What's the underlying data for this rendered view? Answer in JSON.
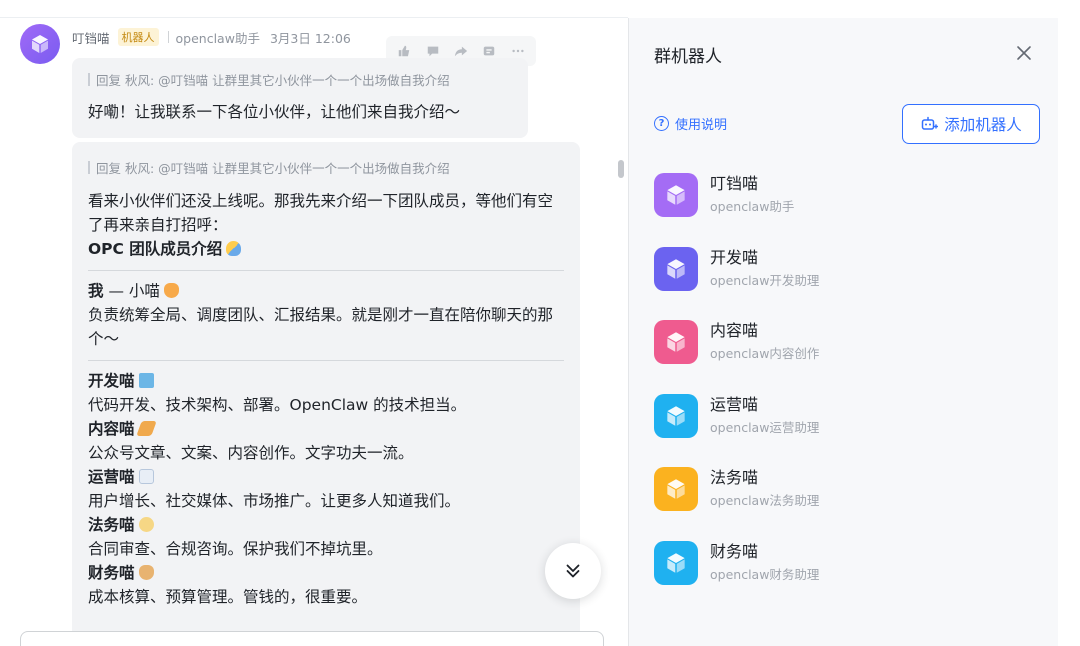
{
  "message": {
    "sender": "叮铛喵",
    "badge": "机器人",
    "source": "openclaw助手",
    "time": "3月3日 12:06",
    "reply1": {
      "quote": "回复 秋风: @叮铛喵 让群里其它小伙伴一个一个出场做自我介绍",
      "text": "好嘞！让我联系一下各位小伙伴，让他们来自我介绍～"
    },
    "reply2": {
      "quote": "回复 秋风: @叮铛喵 让群里其它小伙伴一个一个出场做自我介绍",
      "intro": "看来小伙伴们还没上线呢。那我先来介绍一下团队成员，等他们有空了再来亲自打招呼：",
      "heading": "OPC 团队成员介绍",
      "me_label": "我",
      "me_name": " — 小喵",
      "me_desc": "负责统筹全局、调度团队、汇报结果。就是刚才一直在陪你聊天的那个～",
      "members": [
        {
          "name": "开发喵",
          "desc": "代码开发、技术架构、部署。OpenClaw 的技术担当。",
          "emoji": "laptop-emoji"
        },
        {
          "name": "内容喵",
          "desc": "公众号文章、文案、内容创作。文字功夫一流。",
          "emoji": "writing-hand-emoji"
        },
        {
          "name": "运营喵",
          "desc": "用户增长、社交媒体、市场推广。让更多人知道我们。",
          "emoji": "chart-increasing-emoji"
        },
        {
          "name": "法务喵",
          "desc": "合同审查、合规咨询。保护我们不掉坑里。",
          "emoji": "balance-scale-emoji"
        },
        {
          "name": "财务喵",
          "desc": "成本核算、预算管理。管钱的，很重要。",
          "emoji": "money-bag-emoji"
        }
      ]
    }
  },
  "panel": {
    "title": "群机器人",
    "help_label": "使用说明",
    "add_label": "添加机器人",
    "bots": [
      {
        "name": "叮铛喵",
        "desc": "openclaw助手",
        "color": "#a46cf5"
      },
      {
        "name": "开发喵",
        "desc": "openclaw开发助理",
        "color": "#6b63f0"
      },
      {
        "name": "内容喵",
        "desc": "openclaw内容创作",
        "color": "#ef5b8f"
      },
      {
        "name": "运营喵",
        "desc": "openclaw运营助理",
        "color": "#1fb1f0"
      },
      {
        "name": "法务喵",
        "desc": "openclaw法务助理",
        "color": "#fbb21f"
      },
      {
        "name": "财务喵",
        "desc": "openclaw财务助理",
        "color": "#1fb1f0"
      }
    ]
  },
  "colors": {
    "accent": "#3370ff",
    "bubble": "#f2f3f5",
    "panel_bg": "#f7f8fa"
  }
}
